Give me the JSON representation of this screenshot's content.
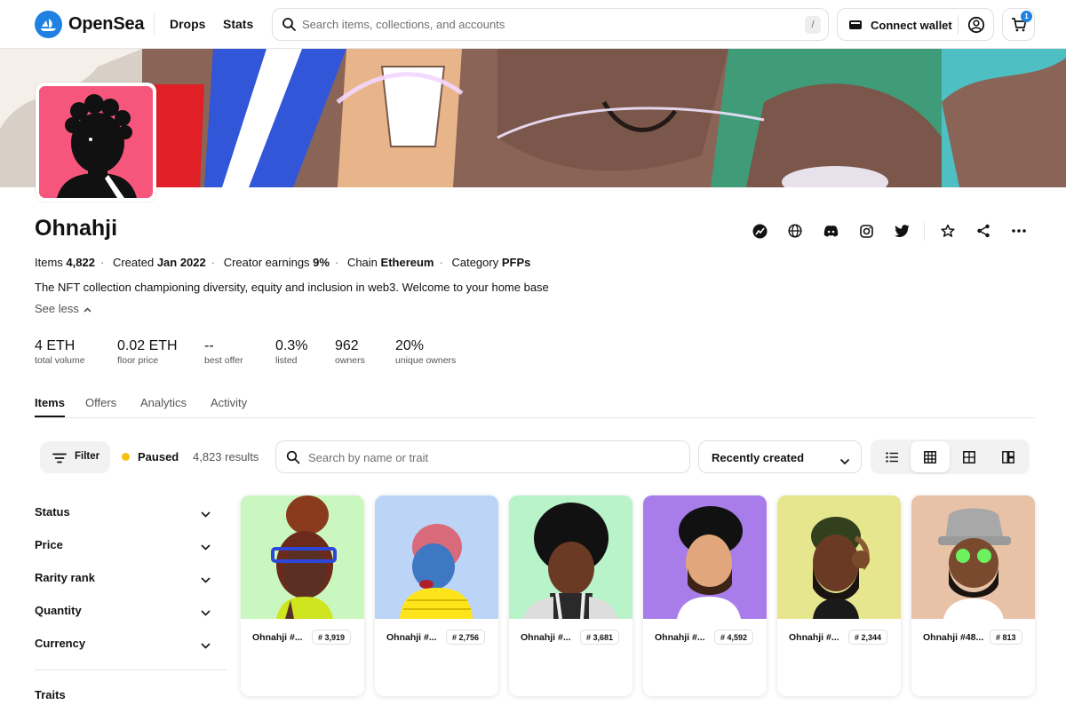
{
  "nav": {
    "logo_text": "OpenSea",
    "links": [
      "Drops",
      "Stats"
    ],
    "search_placeholder": "Search items, collections, and accounts",
    "search_shortcut": "/",
    "connect_wallet": "Connect wallet",
    "cart_count": "1"
  },
  "collection": {
    "name": "Ohnahji",
    "meta": [
      {
        "label": "Items",
        "value": "4,822"
      },
      {
        "label": "Created",
        "value": "Jan 2022"
      },
      {
        "label": "Creator earnings",
        "value": "9%"
      },
      {
        "label": "Chain",
        "value": "Ethereum"
      },
      {
        "label": "Category",
        "value": "PFPs"
      }
    ],
    "description": "The NFT collection championing diversity, equity and inclusion in web3. Welcome to your home base",
    "see_less": "See less",
    "social_icons": [
      "chart-icon",
      "globe-icon",
      "discord-icon",
      "instagram-icon",
      "twitter-icon",
      "star-icon",
      "share-icon",
      "more-icon"
    ]
  },
  "stats": [
    {
      "value": "4 ETH",
      "label": "total volume"
    },
    {
      "value": "0.02 ETH",
      "label": "floor price"
    },
    {
      "value": "--",
      "label": "best offer"
    },
    {
      "value": "0.3%",
      "label": "listed"
    },
    {
      "value": "962",
      "label": "owners"
    },
    {
      "value": "20%",
      "label": "unique owners"
    }
  ],
  "tabs": [
    "Items",
    "Offers",
    "Analytics",
    "Activity"
  ],
  "toolbar": {
    "filter": "Filter",
    "status": "Paused",
    "status_color": "#f5c10f",
    "results": "4,823 results",
    "search_placeholder": "Search by name or trait",
    "sort": "Recently created"
  },
  "sidebar": [
    "Status",
    "Price",
    "Rarity rank",
    "Quantity",
    "Currency",
    "Traits"
  ],
  "cards": [
    {
      "name": "Ohnahji #...",
      "rank": "# 3,919",
      "bg": "#c9f7bf"
    },
    {
      "name": "Ohnahji #...",
      "rank": "# 2,756",
      "bg": "#bcd5f7"
    },
    {
      "name": "Ohnahji #...",
      "rank": "# 3,681",
      "bg": "#b8f3c9"
    },
    {
      "name": "Ohnahji #...",
      "rank": "# 4,592",
      "bg": "#a87de9"
    },
    {
      "name": "Ohnahji #...",
      "rank": "# 2,344",
      "bg": "#e5e68e"
    },
    {
      "name": "Ohnahji #48...",
      "rank": "# 813",
      "bg": "#e8c2a7"
    }
  ]
}
